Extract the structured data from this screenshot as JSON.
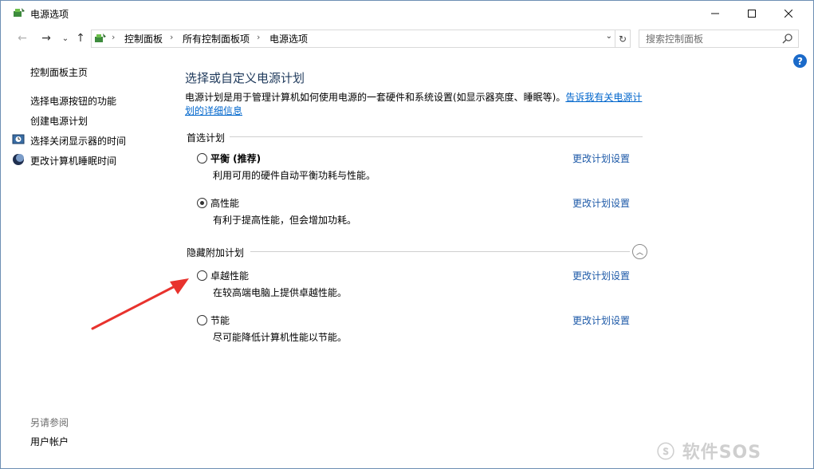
{
  "window": {
    "title": "电源选项"
  },
  "address": {
    "crumbs": [
      "控制面板",
      "所有控制面板项",
      "电源选项"
    ],
    "search_placeholder": "搜索控制面板"
  },
  "sidebar": {
    "home": "控制面板主页",
    "links": [
      "选择电源按钮的功能",
      "创建电源计划",
      "选择关闭显示器的时间",
      "更改计算机睡眠时间"
    ],
    "see_also": "另请参阅",
    "user_accounts": "用户帐户"
  },
  "main": {
    "title": "选择或自定义电源计划",
    "description": "电源计划是用于管理计算机如何使用电源的一套硬件和系统设置(如显示器亮度、睡眠等)。",
    "learn_more": "告诉我有关电源计划的详细信息",
    "preferred_header": "首选计划",
    "hidden_header": "隐藏附加计划",
    "change_label": "更改计划设置",
    "plans": [
      {
        "name": "平衡 (推荐)",
        "desc": "利用可用的硬件自动平衡功耗与性能。",
        "selected": false
      },
      {
        "name": "高性能",
        "desc": "有利于提高性能，但会增加功耗。",
        "selected": true
      },
      {
        "name": "卓越性能",
        "desc": "在较高端电脑上提供卓越性能。",
        "selected": false
      },
      {
        "name": "节能",
        "desc": "尽可能降低计算机性能以节能。",
        "selected": false
      }
    ]
  },
  "watermark": "软件SOS",
  "colors": {
    "link": "#1e5aa8",
    "title": "#1e395b",
    "arrow": "#e8322d",
    "help": "#1b6ac9"
  }
}
